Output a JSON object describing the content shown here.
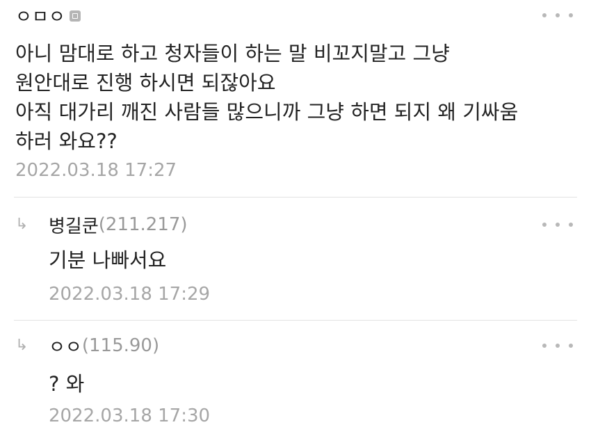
{
  "comments": [
    {
      "author": "ㅇㅁㅇ",
      "ip": "",
      "content": "아니 맘대로 하고 청자들이 하는 말 비꼬지말고 그냥\n원안대로 진행 하시면 되잖아요\n아직 대가리 깨진 사람들 많으니까 그냥 하면 되지 왜 기싸움\n하러 와요??",
      "timestamp": "2022.03.18 17:27"
    }
  ],
  "replies": [
    {
      "arrow": "↳",
      "author": "병길쿤",
      "ip": "(211.217)",
      "content": "기분 나빠서요",
      "timestamp": "2022.03.18 17:29"
    },
    {
      "arrow": "↳",
      "author": "ㅇㅇ",
      "ip": "(115.90)",
      "content": "? 와",
      "timestamp": "2022.03.18 17:30"
    }
  ],
  "icons": {
    "badge": "gallery-member-badge-icon",
    "more": "more-options-icon"
  },
  "colors": {
    "text": "#222222",
    "muted": "#999999",
    "timestamp": "#a6a6a6",
    "divider": "#e3e3e3"
  }
}
